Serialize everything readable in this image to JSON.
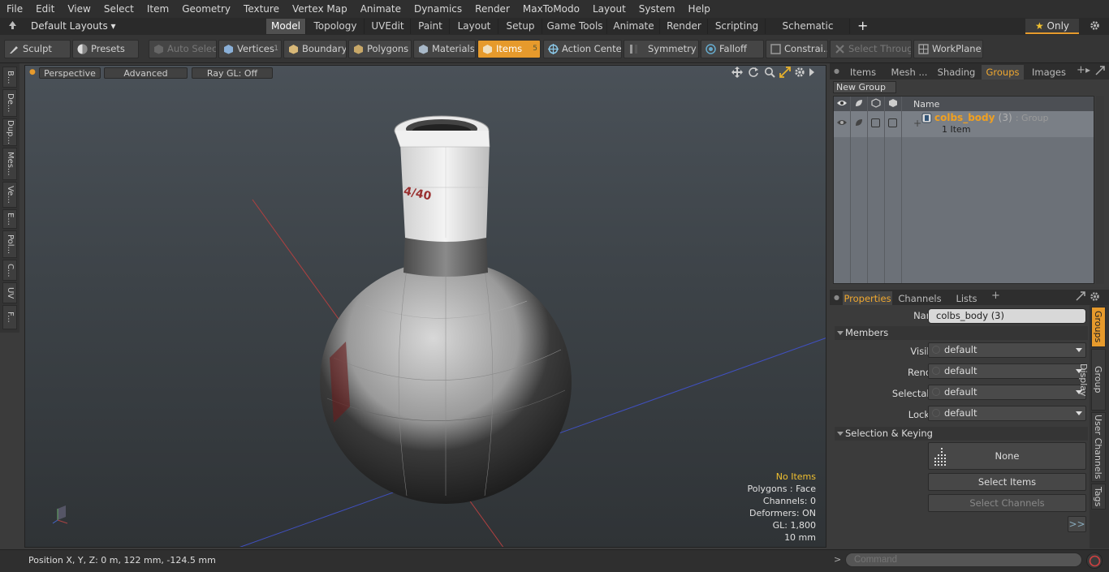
{
  "menu": [
    "File",
    "Edit",
    "View",
    "Select",
    "Item",
    "Geometry",
    "Texture",
    "Vertex Map",
    "Animate",
    "Dynamics",
    "Render",
    "MaxToModo",
    "Layout",
    "System",
    "Help"
  ],
  "layout_selector": "Default Layouts",
  "layout_tabs": [
    "Model",
    "Topology",
    "UVEdit",
    "Paint",
    "Layout",
    "Setup",
    "Game Tools",
    "Animate",
    "Render",
    "Scripting",
    "Schematic Fusion"
  ],
  "active_layout_tab": "Model",
  "only_label": "Only",
  "toolbar": {
    "sculpt": "Sculpt",
    "presets": "Presets",
    "auto_select": "Auto Select",
    "vertices": "Vertices",
    "vertices_count": "1",
    "boundary": "Boundary",
    "polygons": "Polygons",
    "materials": "Materials",
    "items": "Items",
    "items_count": "5",
    "action_center": "Action Center",
    "symmetry": "Symmetry",
    "falloff": "Falloff",
    "constraints": "Constrai...",
    "select_through": "Select Through",
    "workplane": "WorkPlane"
  },
  "left_tabs": [
    "B...",
    "De...",
    "Dup...",
    "Mes...",
    "Ve...",
    "E...",
    "Pol...",
    "C...",
    "UV",
    "F..."
  ],
  "viewport": {
    "view_mode": "Perspective",
    "shading": "Advanced",
    "raygl": "Ray GL: Off",
    "label_text": "4/40",
    "info": {
      "no_items": "No Items",
      "polygons": "Polygons : Face",
      "channels": "Channels: 0",
      "deformers": "Deformers: ON",
      "gl": "GL: 1,800",
      "scale": "10 mm"
    }
  },
  "status": {
    "position": "Position X, Y, Z:   0 m, 122 mm, -124.5 mm"
  },
  "right_tabs": [
    "Items",
    "Mesh ...",
    "Shading",
    "Groups",
    "Images"
  ],
  "active_right_tab": "Groups",
  "groups": {
    "new_group": "New Group",
    "header_name": "Name",
    "row": {
      "name": "colbs_body",
      "count": "(3)",
      "type": ": Group",
      "sub": "1 Item"
    }
  },
  "prop_tabs": [
    "Properties",
    "Channels",
    "Lists"
  ],
  "active_prop_tab": "Properties",
  "properties": {
    "name_label": "Name",
    "name_value": "colbs_body (3)",
    "members_section": "Members",
    "visible_label": "Visible",
    "visible_value": "default",
    "render_label": "Render",
    "render_value": "default",
    "selectable_label": "Selectable",
    "selectable_value": "default",
    "locked_label": "Locked",
    "locked_value": "default",
    "selkey_section": "Selection & Keying",
    "none_label": "None",
    "select_items": "Select Items",
    "select_channels": "Select Channels",
    "more": ">>"
  },
  "right_vtabs": [
    "Groups",
    "Group Display",
    "User Channels",
    "Tags"
  ],
  "command_placeholder": "Command",
  "colors": {
    "accent": "#e69a2c",
    "group_name": "#f0a020",
    "warning": "#f0c030"
  }
}
